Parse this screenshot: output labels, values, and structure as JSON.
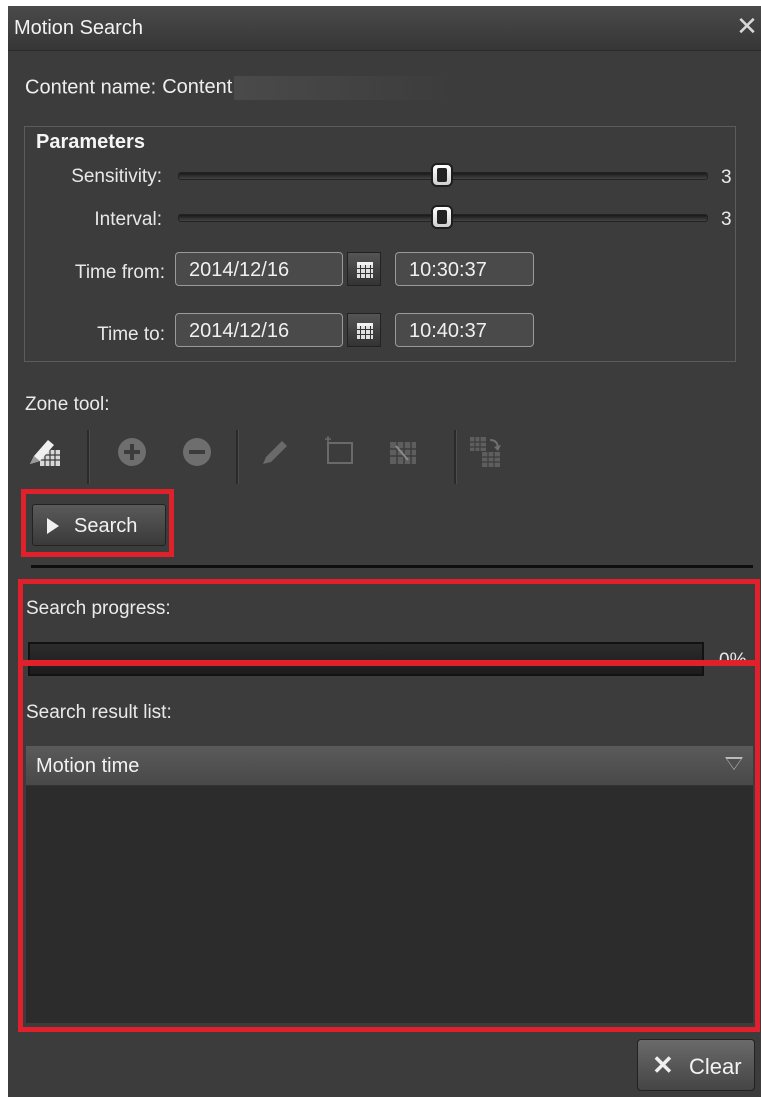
{
  "window": {
    "title": "Motion Search",
    "close_glyph": "✕"
  },
  "content": {
    "label": "Content name:",
    "value": "Content"
  },
  "parameters": {
    "legend": "Parameters",
    "sensitivity": {
      "label": "Sensitivity:",
      "value": "3",
      "level": 0.5
    },
    "interval": {
      "label": "Interval:",
      "value": "3",
      "level": 0.5
    },
    "time_from": {
      "label": "Time from:",
      "date": "2014/12/16",
      "time": "10:30:37"
    },
    "time_to": {
      "label": "Time to:",
      "date": "2014/12/16",
      "time": "10:40:37"
    }
  },
  "zone_tool": {
    "label": "Zone tool:",
    "tools": [
      "edit-grid-icon",
      "add-zone-icon",
      "remove-zone-icon",
      "pencil-icon",
      "rectangle-icon",
      "invert-zone-icon",
      "copy-zone-icon"
    ]
  },
  "search_button": {
    "label": "Search"
  },
  "progress": {
    "label": "Search progress:",
    "value_text": "0%",
    "fraction": 0
  },
  "results": {
    "label": "Search result list:",
    "columns": [
      "Motion time"
    ],
    "rows": []
  },
  "clear_button": {
    "label": "Clear",
    "icon": "✕"
  },
  "colors": {
    "panel_bg": "#3c3c3c",
    "highlight_red": "#e0202a",
    "list_bg": "#2c2c2c"
  }
}
